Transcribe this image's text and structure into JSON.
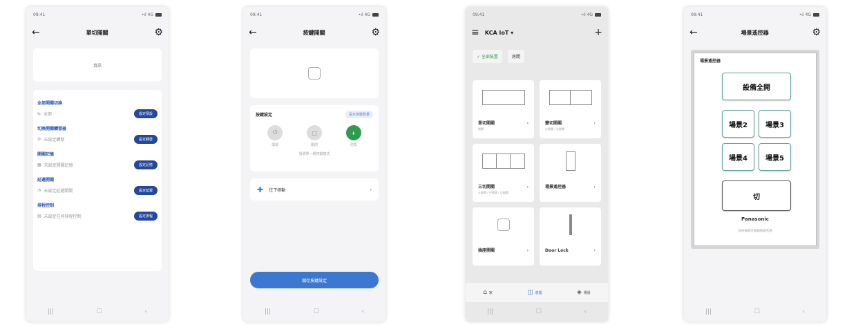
{
  "common": {
    "status_time": "09:41",
    "status_right": "•ıl 4G",
    "nav_back": "|||",
    "nav_home": "☐",
    "nav_recent": "‹"
  },
  "phone1": {
    "title": "單切開關",
    "info_text": "資訊",
    "sections": [
      {
        "title": "全部開關切換",
        "label": "全部",
        "button": "設定預設"
      },
      {
        "title": "切換開關觸發器",
        "label": "未設定觸發",
        "button": "設定觸發"
      },
      {
        "title": "開關記憶",
        "label": "未設定開關記憶",
        "button": "設定記憶"
      },
      {
        "title": "延遲開關",
        "label": "未設定延遲開關",
        "button": "設定延遲"
      },
      {
        "title": "排程控制",
        "label": "未設定任何排程控制",
        "button": "設定排程"
      }
    ]
  },
  "phone2": {
    "title": "按鍵開關",
    "control_title": "按鍵設定",
    "control_badge": "設定按鍵數量",
    "modes": [
      "開啟",
      "關閉",
      "切換"
    ],
    "hint": "請選擇一種按鍵模式",
    "move_label": "往下移動",
    "move_arrow": "›",
    "action_button": "儲存按鍵設定"
  },
  "phone3": {
    "title": "KCA IoT ▾",
    "add": "+",
    "chips": [
      "✓ 全部裝置",
      "房間"
    ],
    "devices": [
      {
        "name": "單切開關",
        "sub": "開關",
        "arrow": "›"
      },
      {
        "name": "雙切開關",
        "sub": "左開關 / 右開關",
        "arrow": "›"
      },
      {
        "name": "三切開關",
        "sub": "左開關 / 中開關 / 右開關",
        "arrow": "›"
      },
      {
        "name": "場景遙控器",
        "sub": "",
        "arrow": "›"
      },
      {
        "name": "插座開關",
        "sub": "",
        "arrow": "›"
      },
      {
        "name": "Door Lock",
        "sub": "",
        "arrow": "›"
      }
    ],
    "bottom_nav": [
      "家",
      "裝置",
      "場景"
    ]
  },
  "phone4": {
    "title": "場景遙控器",
    "panel_caption": "場景遙控器",
    "buttons": [
      "設備全開",
      "場景2",
      "場景3",
      "場景4",
      "場景5",
      "切"
    ],
    "brand": "Panasonic",
    "note": "長按按鍵可編輯按鍵名稱"
  }
}
